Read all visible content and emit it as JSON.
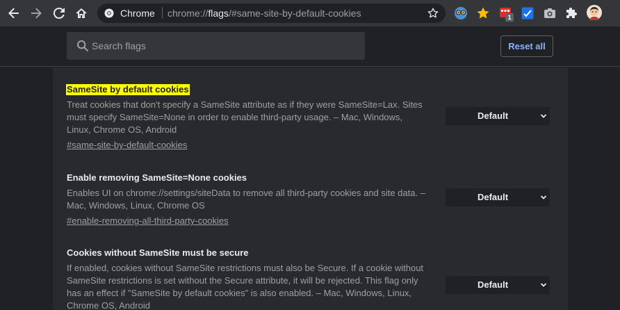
{
  "toolbar": {
    "back_icon": "arrow-left-icon",
    "forward_icon": "arrow-right-icon",
    "reload_icon": "reload-icon",
    "home_icon": "home-icon",
    "omnibox": {
      "chip_label": "Chrome",
      "url_scheme": "chrome://",
      "url_host": "flags",
      "url_path": "/#same-site-by-default-cookies"
    },
    "extensions": [
      {
        "name": "glasses-face-extension-icon"
      },
      {
        "name": "star-extension-icon"
      },
      {
        "name": "red-calendar-extension-icon",
        "badge": "1"
      },
      {
        "name": "blue-check-extension-icon"
      },
      {
        "name": "camera-extension-icon"
      },
      {
        "name": "puzzle-extensions-icon"
      },
      {
        "name": "profile-avatar"
      }
    ]
  },
  "header": {
    "search_placeholder": "Search flags",
    "reset_label": "Reset all"
  },
  "flags": [
    {
      "title": "SameSite by default cookies",
      "highlighted": true,
      "description": "Treat cookies that don't specify a SameSite attribute as if they were SameSite=Lax. Sites must specify SameSite=None in order to enable third-party usage. – Mac, Windows, Linux, Chrome OS, Android",
      "link": "#same-site-by-default-cookies",
      "value": "Default"
    },
    {
      "title": "Enable removing SameSite=None cookies",
      "highlighted": false,
      "description": "Enables UI on chrome://settings/siteData to remove all third-party cookies and site data. – Mac, Windows, Linux, Chrome OS",
      "link": "#enable-removing-all-third-party-cookies",
      "value": "Default"
    },
    {
      "title": "Cookies without SameSite must be secure",
      "highlighted": false,
      "description": "If enabled, cookies without SameSite restrictions must also be Secure. If a cookie without SameSite restrictions is set without the Secure attribute, it will be rejected. This flag only has an effect if \"SameSite by default cookies\" is also enabled. – Mac, Windows, Linux, Chrome OS, Android",
      "link": "",
      "value": "Default"
    }
  ],
  "colors": {
    "toolbar_bg": "#35363a",
    "page_bg": "#202124",
    "panel_bg": "#292a2d",
    "accent": "#8ab4f8",
    "highlight": "#ffff00"
  }
}
